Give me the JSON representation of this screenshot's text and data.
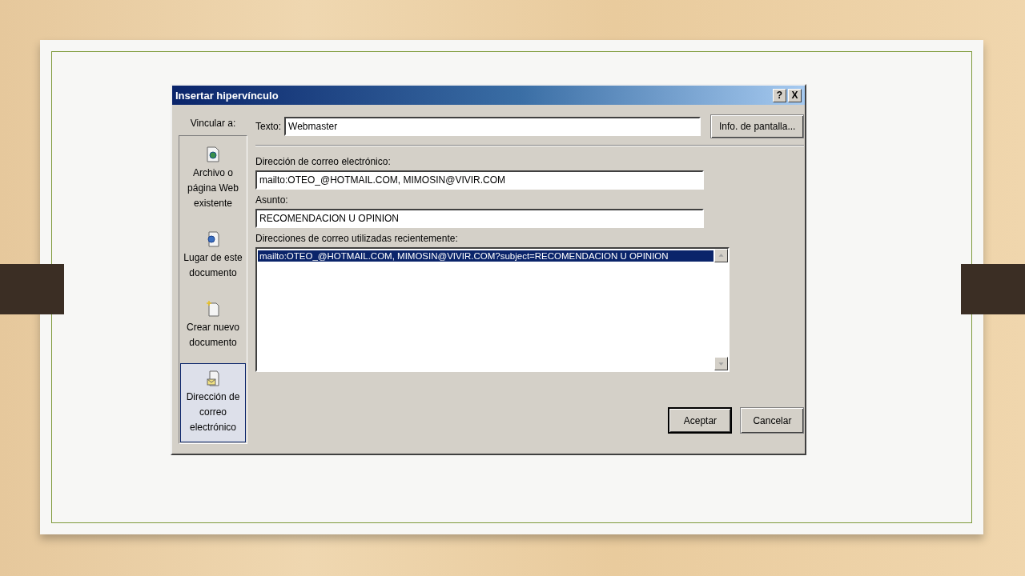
{
  "window": {
    "title": "Insertar hipervínculo",
    "help_button": "?",
    "close_button": "X"
  },
  "link_to": {
    "label": "Vincular a:",
    "items": [
      {
        "kind": "file",
        "label": "Archivo o página Web existente",
        "selected": false
      },
      {
        "kind": "place",
        "label": "Lugar de este documento",
        "selected": false
      },
      {
        "kind": "new",
        "label": "Crear nuevo documento",
        "selected": false
      },
      {
        "kind": "email",
        "label": "Dirección de correo electrónico",
        "selected": true
      }
    ]
  },
  "text_field": {
    "label": "Texto:",
    "value": "Webmaster"
  },
  "screen_tip_button": "Info. de pantalla...",
  "email": {
    "label": "Dirección de correo electrónico:",
    "value": "mailto:OTEO_@HOTMAIL.COM, MIMOSIN@VIVIR.COM"
  },
  "subject": {
    "label": "Asunto:",
    "value": "RECOMENDACION U OPINION"
  },
  "recent": {
    "label": "Direcciones de correo utilizadas recientemente:",
    "items": [
      {
        "text": "mailto:OTEO_@HOTMAIL.COM, MIMOSIN@VIVIR.COM?subject=RECOMENDACION U OPINION",
        "selected": true
      }
    ]
  },
  "buttons": [
    {
      "label": "Aceptar",
      "default": true
    },
    {
      "label": "Cancelar",
      "default": false
    }
  ]
}
